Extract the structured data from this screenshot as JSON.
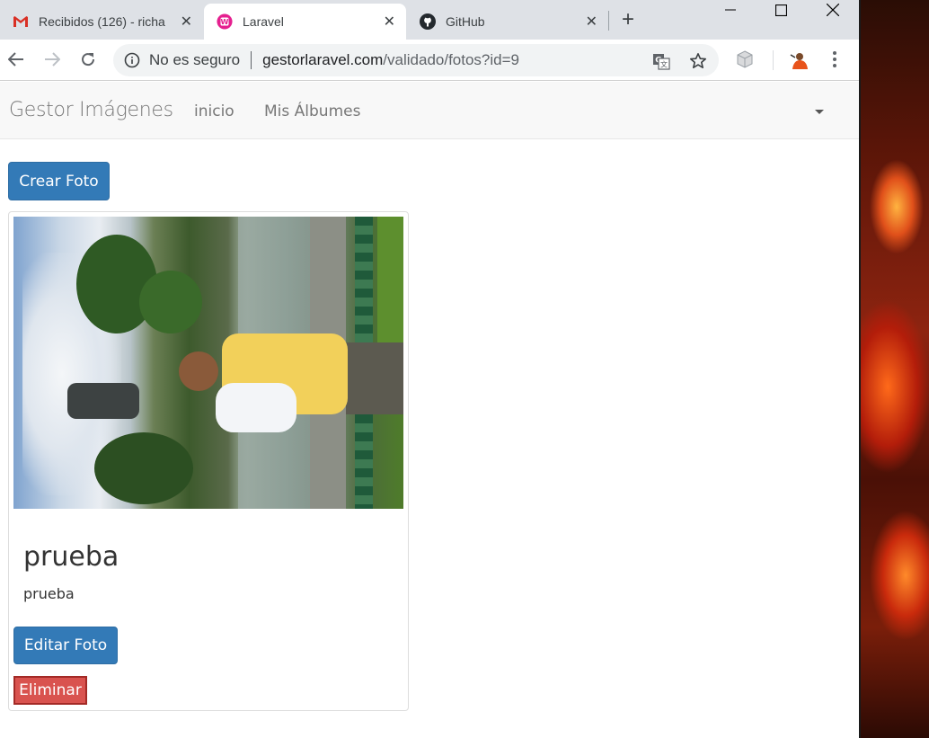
{
  "browser": {
    "tabs": [
      {
        "title": "Recibidos (126) - richa",
        "icon": "gmail-icon",
        "active": false
      },
      {
        "title": "Laravel",
        "icon": "laravel-icon",
        "active": true
      },
      {
        "title": "GitHub",
        "icon": "github-icon",
        "active": false
      }
    ],
    "security_label": "No es seguro",
    "url_host": "gestorlaravel.com",
    "url_path": "/validado/fotos?id=9"
  },
  "navbar": {
    "brand": "Gestor Imágenes",
    "links": [
      "inicio",
      "Mis Álbumes"
    ]
  },
  "page": {
    "create_button": "Crear Foto",
    "photo": {
      "title": "prueba",
      "description": "prueba",
      "edit_button": "Editar Foto",
      "delete_button": "Eliminar"
    }
  },
  "colors": {
    "primary": "#337ab7",
    "danger": "#d9534f",
    "navbar_bg": "#f8f8f8"
  }
}
